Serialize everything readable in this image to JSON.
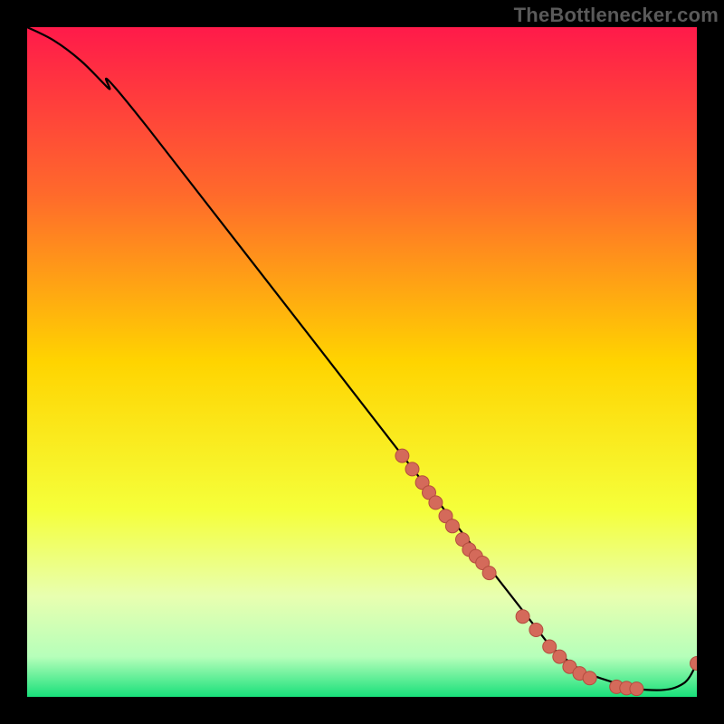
{
  "watermark": "TheBottlenecker.com",
  "colors": {
    "gradient_stops": [
      {
        "offset": 0,
        "color": "#ff1a4a"
      },
      {
        "offset": 0.25,
        "color": "#ff6a2b"
      },
      {
        "offset": 0.5,
        "color": "#ffd400"
      },
      {
        "offset": 0.72,
        "color": "#f5ff3a"
      },
      {
        "offset": 0.85,
        "color": "#e8ffb0"
      },
      {
        "offset": 0.94,
        "color": "#b6ffba"
      },
      {
        "offset": 1.0,
        "color": "#18e07a"
      }
    ],
    "curve": "#000000",
    "marker_fill": "#d46a5a",
    "marker_stroke": "#b44c3e"
  },
  "chart_data": {
    "type": "line",
    "title": "",
    "xlabel": "",
    "ylabel": "",
    "xlim": [
      0,
      100
    ],
    "ylim": [
      0,
      100
    ],
    "series": [
      {
        "name": "curve",
        "x": [
          0,
          4,
          8,
          12,
          18,
          70,
          80,
          88,
          94,
          98,
          100
        ],
        "y": [
          100,
          98,
          95,
          91,
          85,
          18,
          6,
          2,
          1,
          2,
          5
        ]
      }
    ],
    "markers": {
      "name": "highlighted-points",
      "x": [
        56,
        57.5,
        59,
        60,
        61,
        62.5,
        63.5,
        65,
        66,
        67,
        68,
        69,
        74,
        76,
        78,
        79.5,
        81,
        82.5,
        84,
        88,
        89.5,
        91,
        100
      ],
      "y": [
        36,
        34,
        32,
        30.5,
        29,
        27,
        25.5,
        23.5,
        22,
        21,
        20,
        18.5,
        12,
        10,
        7.5,
        6,
        4.5,
        3.5,
        2.8,
        1.5,
        1.3,
        1.2,
        5
      ]
    }
  }
}
